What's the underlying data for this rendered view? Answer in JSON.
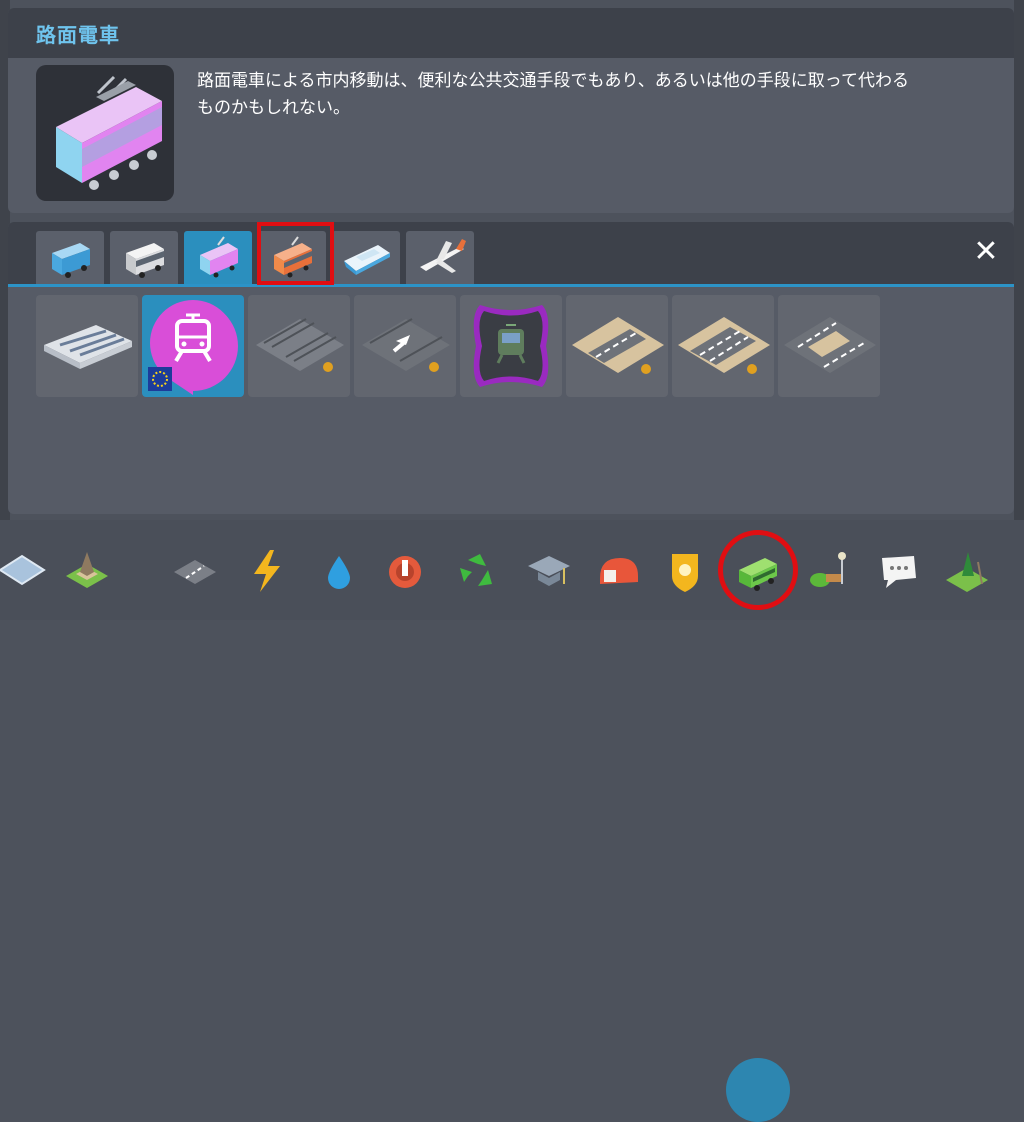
{
  "info": {
    "title": "路面電車",
    "description_line1": "路面電車による市内移動は、便利な公共交通手段でもあり、あるいは他の手段に取って代わる",
    "description_line2": "ものかもしれない。"
  },
  "tabs": [
    {
      "name": "bus",
      "icon": "bus-icon"
    },
    {
      "name": "intercity-bus",
      "icon": "coach-icon"
    },
    {
      "name": "tram",
      "icon": "tram-icon",
      "active": true
    },
    {
      "name": "train",
      "icon": "train-icon",
      "highlighted": true
    },
    {
      "name": "ship",
      "icon": "ship-icon"
    },
    {
      "name": "airplane",
      "icon": "airplane-icon"
    }
  ],
  "close_label": "✕",
  "tools": [
    {
      "name": "tram-depot",
      "icon": "depot-icon"
    },
    {
      "name": "tram-stop",
      "icon": "tram-stop-icon",
      "selected": true
    },
    {
      "name": "tram-track",
      "icon": "track-icon"
    },
    {
      "name": "one-way-tram-track",
      "icon": "one-way-track-icon"
    },
    {
      "name": "tram-line",
      "icon": "tram-line-icon"
    },
    {
      "name": "road-with-tram-1",
      "icon": "road-tram-icon"
    },
    {
      "name": "road-with-tram-2",
      "icon": "road-tram-icon"
    },
    {
      "name": "road-with-tram-3",
      "icon": "road-tram-icon"
    }
  ],
  "toolbar": [
    "zoning-icon",
    "district-icon",
    "roads-icon",
    "electricity-icon",
    "water-icon",
    "garbage-icon",
    "recycling-icon",
    "education-icon",
    "fire-icon",
    "police-icon",
    "transport-icon",
    "parks-icon",
    "chirper-icon",
    "landscaping-icon"
  ],
  "colors": {
    "accent": "#2b8fbe",
    "highlight": "#e00e12",
    "title": "#6fc4ee",
    "tram_pink": "#e184f0"
  }
}
